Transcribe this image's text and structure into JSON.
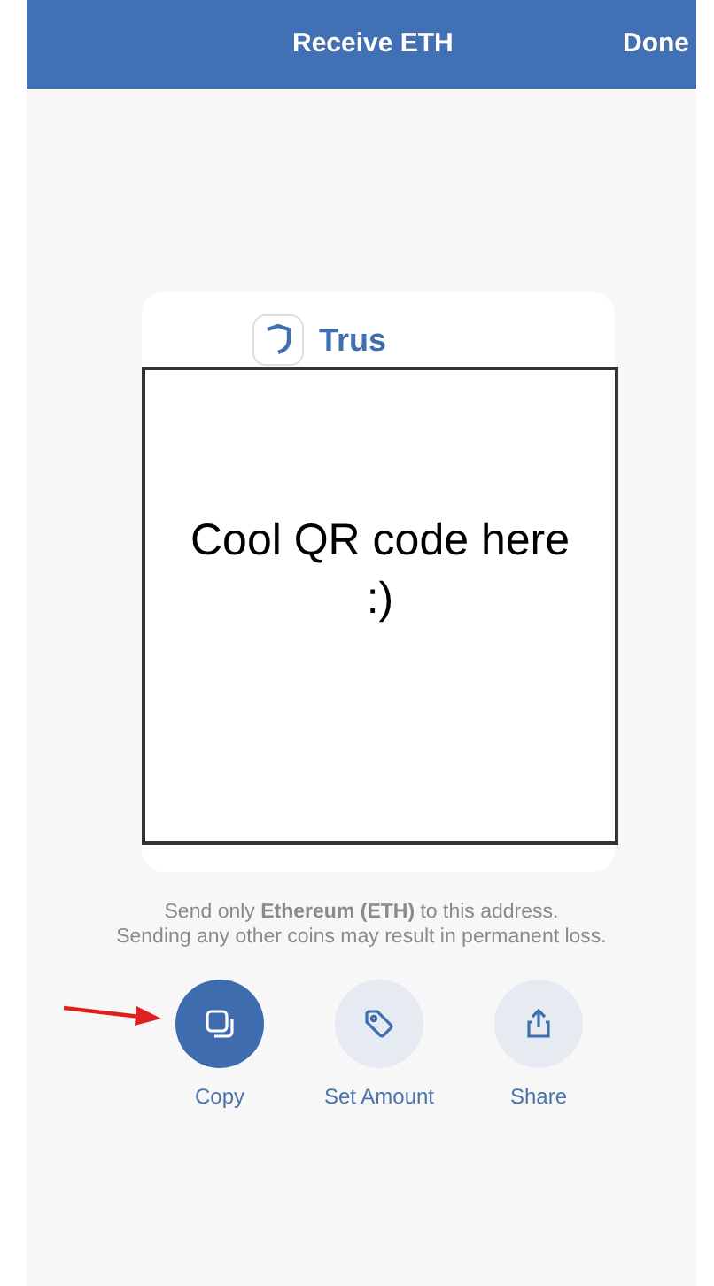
{
  "header": {
    "title": "Receive ETH",
    "done": "Done"
  },
  "card": {
    "brand": "Trus",
    "overlay_text": "Cool QR code here :)"
  },
  "warning": [
    "Send only **Ethereum (ETH)** to this address.",
    "Sending any other coins may result in permanent loss."
  ],
  "actions": [
    {
      "kind": "copy",
      "label": "Copy",
      "selected": true
    },
    {
      "kind": "tag",
      "label": "Set Amount",
      "selected": false
    },
    {
      "kind": "share",
      "label": "Share",
      "selected": false
    }
  ]
}
